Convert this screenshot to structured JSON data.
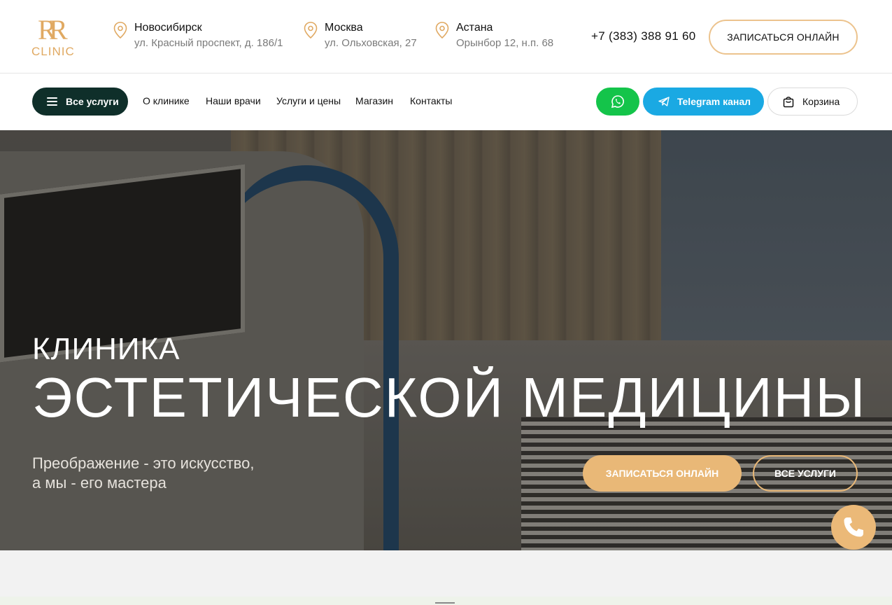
{
  "brand": {
    "logo_monogram": "RR",
    "logo_word": "CLINIC",
    "accent_color": "#e0a962"
  },
  "header": {
    "locations": [
      {
        "city": "Новосибирск",
        "address": "ул. Красный проспект, д. 186/1",
        "icon": "map-pin-icon"
      },
      {
        "city": "Москва",
        "address": "ул. Ольховская, 27",
        "icon": "map-pin-icon"
      },
      {
        "city": "Астана",
        "address": "Орынбор 12, н.п. 68",
        "icon": "map-pin-icon"
      }
    ],
    "phone": "+7 (383) 388 91 60",
    "book_button": "ЗАПИСАТЬСЯ ОНЛАЙН"
  },
  "nav": {
    "all_services": "Все услуги",
    "links": [
      "О клинике",
      "Наши врачи",
      "Услуги и цены",
      "Магазин",
      "Контакты"
    ],
    "whatsapp_icon": "whatsapp-icon",
    "telegram": "Telegram канал",
    "cart": "Корзина",
    "colors": {
      "dark": "#0f2f2a",
      "whatsapp": "#14c44a",
      "telegram": "#1aa9e3"
    }
  },
  "hero": {
    "title_line1": "КЛИНИКА",
    "title_line2": "ЭСТЕТИЧЕСКОЙ МЕДИЦИНЫ",
    "subtitle_line1": "Преображение - это искусство,",
    "subtitle_line2": "а мы - его мастера",
    "primary_button": "ЗАПИСАТЬСЯ ОНЛАЙН",
    "secondary_button": "ВСЕ УСЛУГИ",
    "button_color": "#e9b877"
  },
  "floating": {
    "call_icon": "phone-icon"
  }
}
